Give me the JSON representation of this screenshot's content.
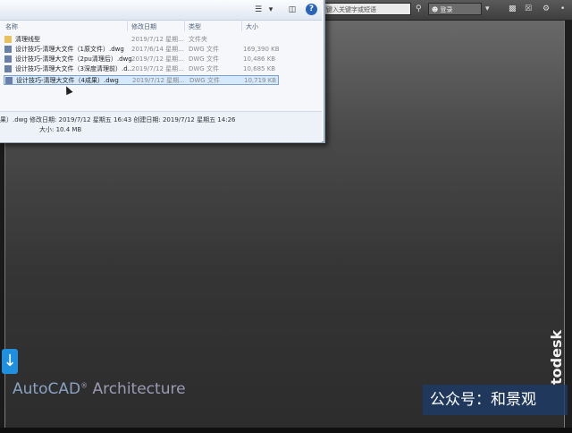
{
  "topbar": {
    "search_placeholder": "键入关键字或短语",
    "user_label": "登录"
  },
  "dialog": {
    "columns": [
      "名称",
      "修改日期",
      "类型",
      "大小"
    ],
    "rows": [
      {
        "name": "清理线型",
        "date": "2019/7/12 星期...",
        "type": "文件夹",
        "size": "",
        "kind": "folder"
      },
      {
        "name": "设计技巧-清理大文件（1原文件）.dwg",
        "date": "2017/6/14 星期...",
        "type": "DWG 文件",
        "size": "169,390 KB",
        "kind": "dwg"
      },
      {
        "name": "设计技巧-清理大文件（2pu清理后）.dwg",
        "date": "2019/7/12 星期...",
        "type": "DWG 文件",
        "size": "10,486 KB",
        "kind": "dwg"
      },
      {
        "name": "设计技巧-清理大文件（3深度清理前）.d...",
        "date": "2019/7/12 星期...",
        "type": "DWG 文件",
        "size": "10,685 KB",
        "kind": "dwg"
      },
      {
        "name": "设计技巧-清理大文件（4成果）.dwg",
        "date": "2019/7/12 星期...",
        "type": "DWG 文件",
        "size": "10,719 KB",
        "kind": "dwg",
        "selected": true
      }
    ],
    "details": {
      "line1": "果）.dwg  修改日期: 2019/7/12 星期五 16:43  创建日期: 2019/7/12 星期五 14:26",
      "line2": "大小: 10.4 MB"
    }
  },
  "brand": {
    "autocad": "AutoCAD",
    "reg": "®",
    "suffix": " Architecture",
    "vendor": "todesk"
  },
  "watermark": "公众号：和景观",
  "down_arrow": "↓",
  "help_glyph": "?",
  "colors": {
    "selection": "#d6e8fb",
    "accent_blue": "#1f8fe0",
    "brand_text": "#9b9bb5"
  }
}
